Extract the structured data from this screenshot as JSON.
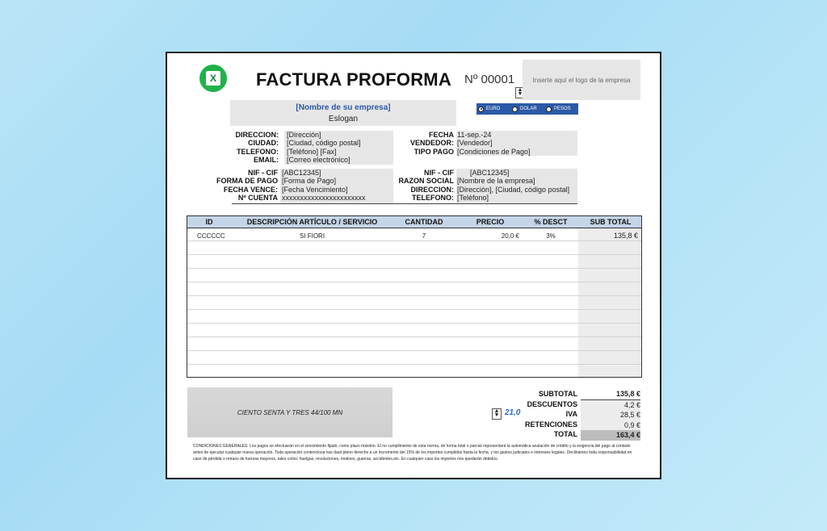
{
  "header": {
    "title": "FACTURA PROFORMA",
    "invoice_number": "Nº 00001",
    "logo_placeholder": "Inserte aquí el logo de la empresa",
    "company_name": "[Nombre de su empresa]",
    "slogan": "Eslogan"
  },
  "currency": {
    "options": [
      "EURO",
      "DOLAR",
      "PESOS"
    ],
    "selected": "EURO"
  },
  "company_info": {
    "labels": [
      "DIRECCION:",
      "CIUDAD:",
      "TELEFONO:",
      "EMAIL:"
    ],
    "values": [
      "[Dirección]",
      "[Ciudad, código postal]",
      "[Teléfono] [Fax]",
      "[Correo electrónico]"
    ]
  },
  "invoice_meta": {
    "labels": [
      "FECHA",
      "VENDEDOR:",
      "TIPO PAGO"
    ],
    "values": [
      "11-sep.-24",
      "[Vendedor]",
      "[Condiciones de Pago]"
    ]
  },
  "payment_info": {
    "labels": [
      "NIF - CIF",
      "FORMA DE PAGO",
      "FECHA VENCE:",
      "Nº CUENTA"
    ],
    "values": [
      "[ABC12345]",
      "[Forma de Pago]",
      "[Fecha Vencimiento]",
      "xxxxxxxxxxxxxxxxxxxxxxx"
    ]
  },
  "client_info": {
    "labels": [
      "NIF - CIF",
      "RAZON SOCIAL",
      "DIRECCION:",
      "TELEFONO:"
    ],
    "values": [
      "[ABC12345]",
      "[Nombre de la empresa]",
      "[Dirección], [Ciudad, código postal]",
      "[Teléfono]"
    ]
  },
  "items_table": {
    "headers": [
      "ID",
      "DESCRIPCIÓN ARTÍCULO / SERVICIO",
      "CANTIDAD",
      "PRECIO",
      "% DESCT",
      "SUB TOTAL"
    ],
    "rows": [
      {
        "id": "CCCCCC",
        "description": "SI FIORI",
        "quantity": "7",
        "price": "20,0 €",
        "discount": "3%",
        "subtotal": "135,8 €"
      }
    ]
  },
  "amount_in_words": "CIENTO SENTA Y TRES 44/100 MN",
  "tax_percent": "21,0",
  "totals": {
    "labels": [
      "SUBTOTAL",
      "DESCUENTOS",
      "IVA",
      "RETENCIONES",
      "TOTAL"
    ],
    "values": [
      "135,8 €",
      "4,2 €",
      "28,5 €",
      "0,9 €",
      "163,4 €"
    ]
  },
  "conditions": "CONDICIONES GENERALES: Los pagos se efectuarán en el vencimiento fijado, como plazo máximo. El no cumplimiento de esta norma, de forma total o parcial representará la automática anulación de crédito y la exigencia del pago al contado antes de ejecutar cualquier nueva operación. Toda operación contenciosa nos dará pleno derecho a un incremento del 15% de los importes cumplidos hasta la fecha, y los gastos judiciales e intereses legales. Declinamos toda responsabilidad en caso de pérdida o retraso de fuerzas mayores, tales como: huelgas, revoluciones, motines, guerras, accidentes,etc. En cualquier caso los importes nos quedarán debidos.",
  "colors": {
    "accent_blue": "#2b5aa6",
    "excel_green": "#1fb24a",
    "header_fill": "#c5d5e8",
    "pct_blue": "#2b6cc2"
  },
  "icons": [
    "excel-logo-icon",
    "spinner-icon",
    "radio-icon"
  ]
}
